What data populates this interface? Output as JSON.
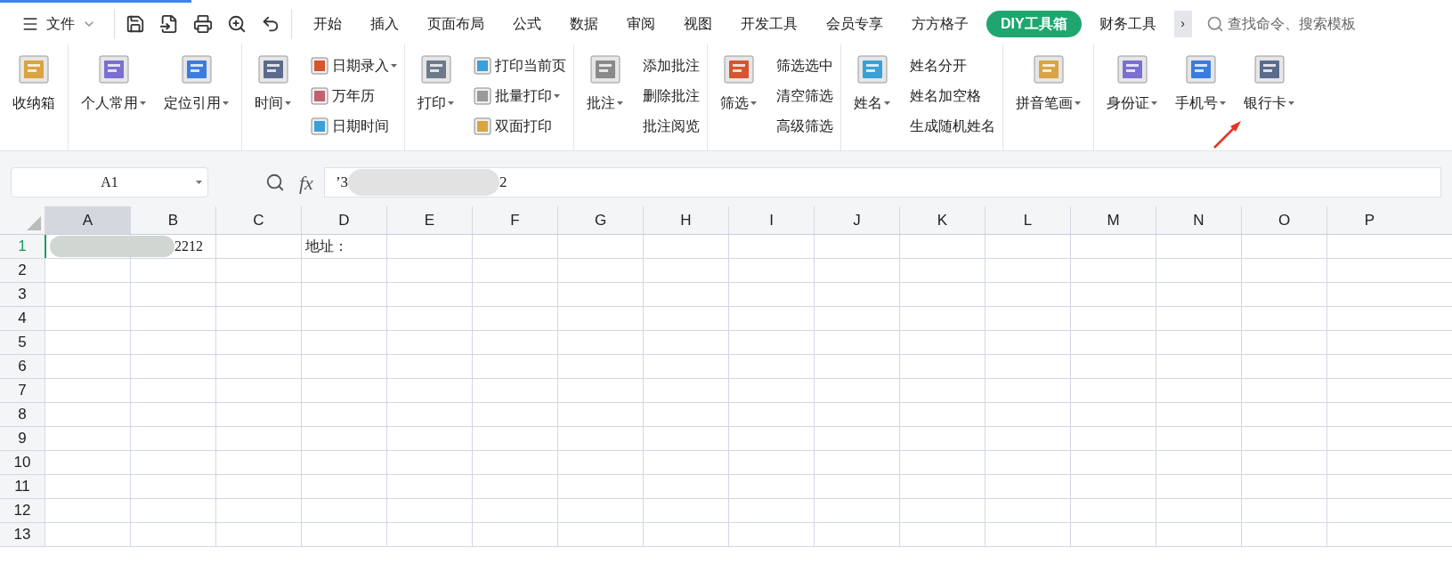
{
  "menu": {
    "label": "文件"
  },
  "tabs": [
    {
      "label": "开始",
      "selected": false
    },
    {
      "label": "插入",
      "selected": false
    },
    {
      "label": "页面布局",
      "selected": false
    },
    {
      "label": "公式",
      "selected": false
    },
    {
      "label": "数据",
      "selected": false
    },
    {
      "label": "审阅",
      "selected": false
    },
    {
      "label": "视图",
      "selected": false
    },
    {
      "label": "开发工具",
      "selected": false
    },
    {
      "label": "会员专享",
      "selected": false
    },
    {
      "label": "方方格子",
      "selected": false
    },
    {
      "label": "DIY工具箱",
      "selected": true
    },
    {
      "label": "财务工具",
      "selected": false
    }
  ],
  "more_button": {
    "label": "›"
  },
  "search": {
    "placeholder": "查找命令、搜索模板"
  },
  "ribbon_groups": [
    {
      "items": [
        {
          "kind": "large",
          "label": "收纳箱",
          "dropdown": false
        }
      ]
    },
    {
      "items": [
        {
          "kind": "large",
          "label": "个人常用",
          "dropdown": true
        },
        {
          "kind": "large",
          "label": "定位引用",
          "dropdown": true
        }
      ]
    },
    {
      "items": [
        {
          "kind": "large",
          "label": "时间",
          "dropdown": true
        },
        {
          "kind": "column",
          "items": [
            {
              "label": "日期录入",
              "dropdown": true,
              "icon": true
            },
            {
              "label": "万年历",
              "dropdown": false,
              "icon": true
            },
            {
              "label": "日期时间",
              "dropdown": false,
              "icon": true
            }
          ]
        }
      ]
    },
    {
      "items": [
        {
          "kind": "large",
          "label": "打印",
          "dropdown": true
        },
        {
          "kind": "column",
          "items": [
            {
              "label": "打印当前页",
              "dropdown": false,
              "icon": true
            },
            {
              "label": "批量打印",
              "dropdown": true,
              "icon": true
            },
            {
              "label": "双面打印",
              "dropdown": false,
              "icon": true
            }
          ]
        }
      ]
    },
    {
      "items": [
        {
          "kind": "large",
          "label": "批注",
          "dropdown": true
        },
        {
          "kind": "column",
          "items": [
            {
              "label": "添加批注",
              "dropdown": false,
              "icon": false
            },
            {
              "label": "删除批注",
              "dropdown": false,
              "icon": false
            },
            {
              "label": "批注阅览",
              "dropdown": false,
              "icon": false
            }
          ]
        }
      ]
    },
    {
      "items": [
        {
          "kind": "large",
          "label": "筛选",
          "dropdown": true
        },
        {
          "kind": "column",
          "items": [
            {
              "label": "筛选选中",
              "dropdown": false,
              "icon": false
            },
            {
              "label": "清空筛选",
              "dropdown": false,
              "icon": false
            },
            {
              "label": "高级筛选",
              "dropdown": false,
              "icon": false
            }
          ]
        }
      ]
    },
    {
      "items": [
        {
          "kind": "large",
          "label": "姓名",
          "dropdown": true
        },
        {
          "kind": "column",
          "items": [
            {
              "label": "姓名分开",
              "dropdown": false,
              "icon": false
            },
            {
              "label": "姓名加空格",
              "dropdown": false,
              "icon": false
            },
            {
              "label": "生成随机姓名",
              "dropdown": false,
              "icon": false
            }
          ]
        }
      ]
    },
    {
      "items": [
        {
          "kind": "large",
          "label": "拼音笔画",
          "dropdown": true
        }
      ]
    },
    {
      "items": [
        {
          "kind": "large",
          "label": "身份证",
          "dropdown": true
        },
        {
          "kind": "large",
          "label": "手机号",
          "dropdown": true
        },
        {
          "kind": "large",
          "label": "银行卡",
          "dropdown": true
        }
      ]
    }
  ],
  "name_box": {
    "value": "A1"
  },
  "formula": {
    "label": "fx",
    "value_start": "’3",
    "value_end": "2",
    "redacted": true
  },
  "columns": [
    {
      "label": "A",
      "selected": true
    },
    {
      "label": "B",
      "selected": false
    },
    {
      "label": "C",
      "selected": false
    },
    {
      "label": "D",
      "selected": false
    },
    {
      "label": "E",
      "selected": false
    },
    {
      "label": "F",
      "selected": false
    },
    {
      "label": "G",
      "selected": false
    },
    {
      "label": "H",
      "selected": false
    },
    {
      "label": "I",
      "selected": false
    },
    {
      "label": "J",
      "selected": false
    },
    {
      "label": "K",
      "selected": false
    },
    {
      "label": "L",
      "selected": false
    },
    {
      "label": "M",
      "selected": false
    },
    {
      "label": "N",
      "selected": false
    },
    {
      "label": "O",
      "selected": false
    },
    {
      "label": "P",
      "selected": false
    }
  ],
  "rows": [
    {
      "label": "1",
      "selected": true,
      "cells": [
        {
          "value": "2212",
          "redacted": true
        },
        null,
        null,
        {
          "value": "地址：",
          "redacted": false
        }
      ]
    },
    {
      "label": "2",
      "selected": false
    },
    {
      "label": "3",
      "selected": false
    },
    {
      "label": "4",
      "selected": false
    },
    {
      "label": "5",
      "selected": false
    },
    {
      "label": "6",
      "selected": false
    },
    {
      "label": "7",
      "selected": false
    },
    {
      "label": "8",
      "selected": false
    },
    {
      "label": "9",
      "selected": false
    },
    {
      "label": "10",
      "selected": false
    },
    {
      "label": "11",
      "selected": false
    },
    {
      "label": "12",
      "selected": false
    },
    {
      "label": "13",
      "selected": false
    }
  ]
}
